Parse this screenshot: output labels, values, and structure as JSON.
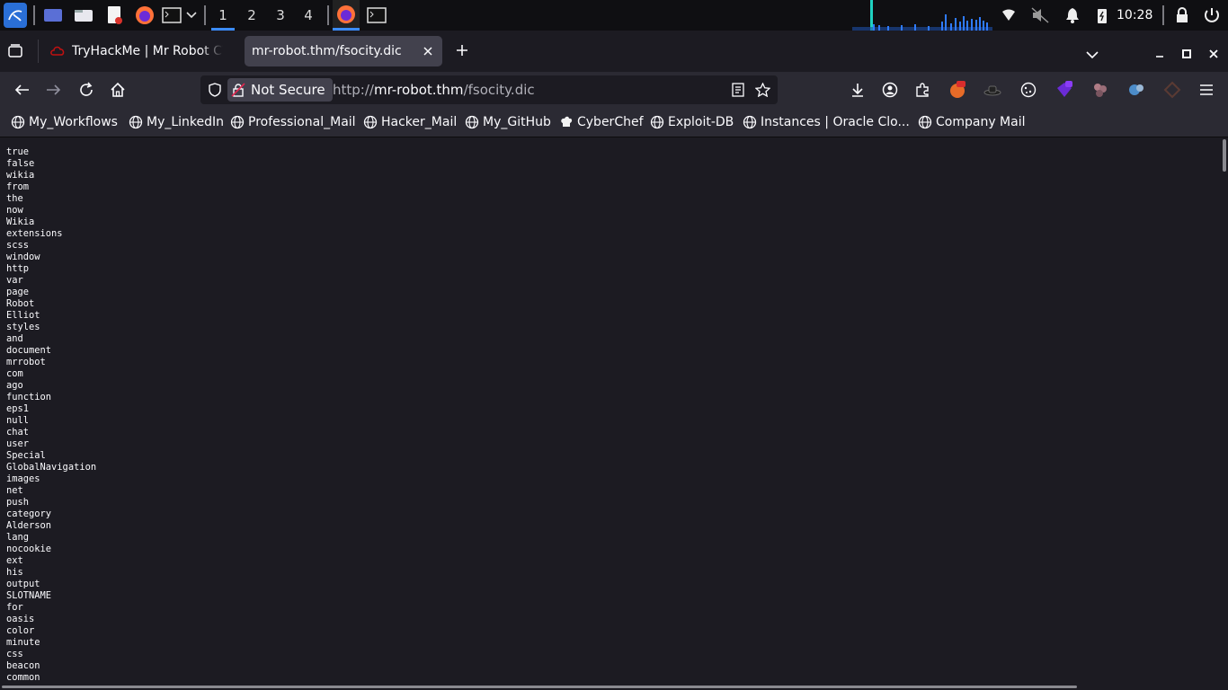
{
  "taskbar": {
    "workspaces": [
      "1",
      "2",
      "3",
      "4"
    ],
    "active_workspace": "1",
    "clock": "10:28",
    "accent": "#3b8cff"
  },
  "tabs": [
    {
      "title": "TryHackMe | Mr Robot CTF",
      "icon": "tryhackme-icon",
      "active": false
    },
    {
      "title": "mr-robot.thm/fsocity.dic",
      "icon": "",
      "active": true
    }
  ],
  "navbar": {
    "security_label": "Not Secure",
    "url_prefix": "http://",
    "url_host": "mr-robot.thm",
    "url_path": "/fsocity.dic"
  },
  "bookmarks": [
    "My_Workflows",
    "My_LinkedIn",
    "Professional_Mail",
    "Hacker_Mail",
    "My_GitHub",
    "CyberChef",
    "Exploit-DB",
    "Instances | Oracle Clo...",
    "Company Mail"
  ],
  "content": {
    "lines": [
      "true",
      "false",
      "wikia",
      "from",
      "the",
      "now",
      "Wikia",
      "extensions",
      "scss",
      "window",
      "http",
      "var",
      "page",
      "Robot",
      "Elliot",
      "styles",
      "and",
      "document",
      "mrrobot",
      "com",
      "ago",
      "function",
      "eps1",
      "null",
      "chat",
      "user",
      "Special",
      "GlobalNavigation",
      "images",
      "net",
      "push",
      "category",
      "Alderson",
      "lang",
      "nocookie",
      "ext",
      "his",
      "output",
      "SLOTNAME",
      "for",
      "oasis",
      "color",
      "minute",
      "css",
      "beacon",
      "common"
    ]
  }
}
